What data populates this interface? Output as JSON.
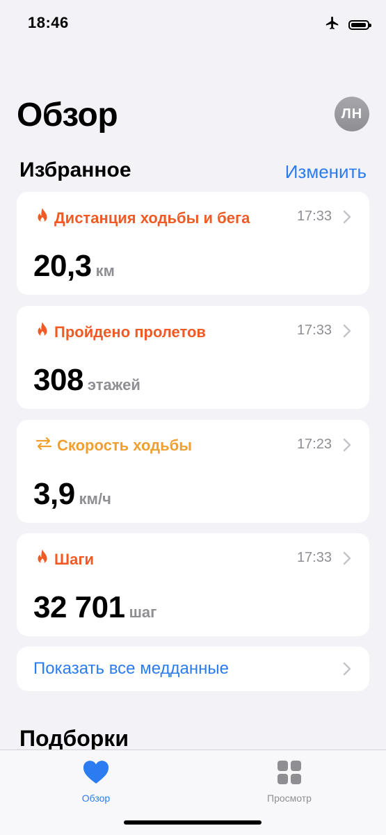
{
  "status_bar": {
    "time": "18:46"
  },
  "header": {
    "title": "Обзор",
    "avatar_initials": "ЛН"
  },
  "favorites": {
    "title": "Избранное",
    "edit_label": "Изменить",
    "cards": [
      {
        "title": "Дистанция ходьбы и бега",
        "time": "17:33",
        "value": "20,3",
        "unit": "км",
        "icon": "flame-icon",
        "color": "#f05a24"
      },
      {
        "title": "Пройдено пролетов",
        "time": "17:33",
        "value": "308",
        "unit": "этажей",
        "icon": "flame-icon",
        "color": "#f05a24"
      },
      {
        "title": "Скорость ходьбы",
        "time": "17:23",
        "value": "3,9",
        "unit": "км/ч",
        "icon": "arrows-swap-icon",
        "color": "#f0a030"
      },
      {
        "title": "Шаги",
        "time": "17:33",
        "value": "32 701",
        "unit": "шаг",
        "icon": "flame-icon",
        "color": "#f05a24"
      }
    ],
    "show_all_label": "Показать все медданные"
  },
  "collections": {
    "title": "Подборки"
  },
  "tab_bar": {
    "tabs": [
      {
        "label": "Обзор",
        "icon": "heart-icon",
        "active": true,
        "color": "#2b7cf0"
      },
      {
        "label": "Просмотр",
        "icon": "grid-icon",
        "active": false,
        "color": "#8e8e93"
      }
    ]
  }
}
